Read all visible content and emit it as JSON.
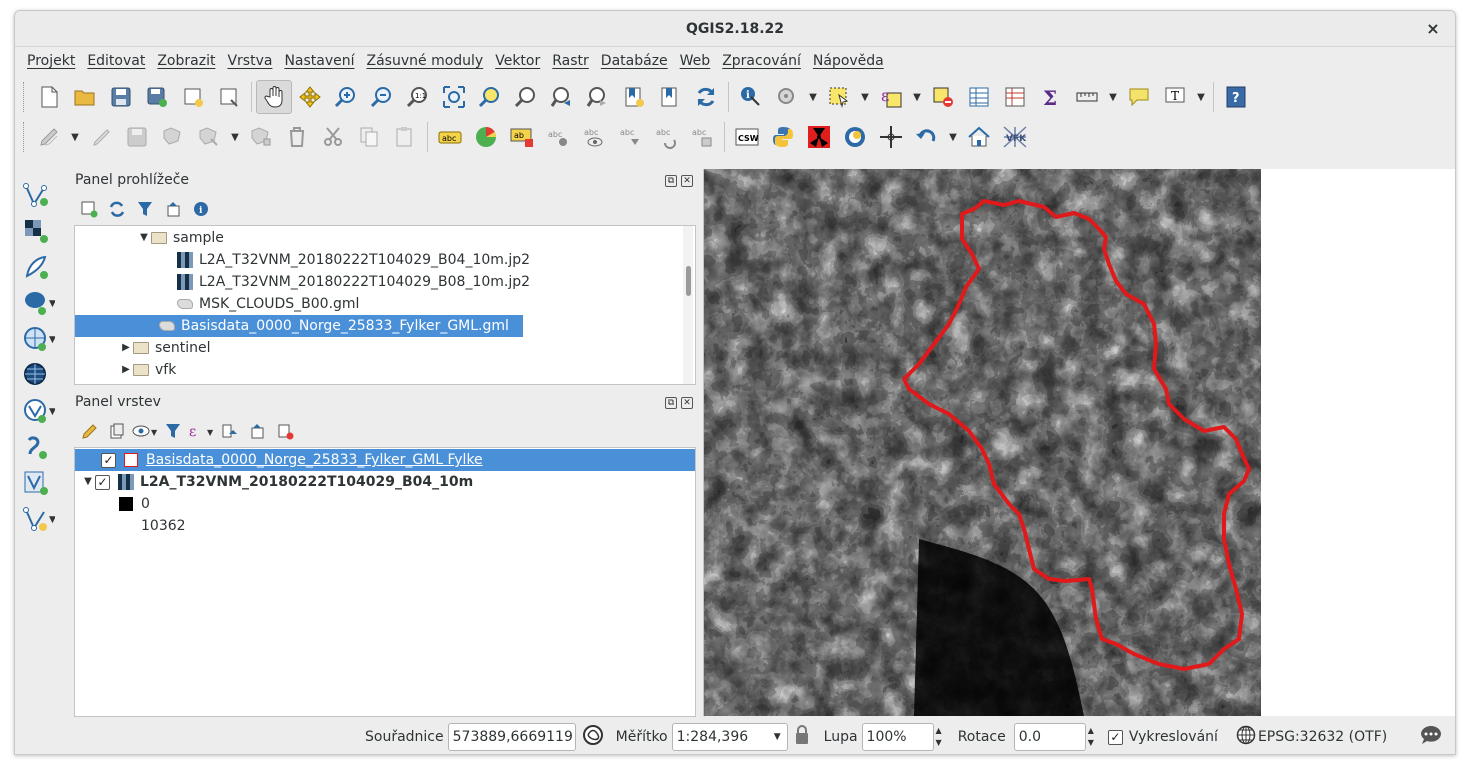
{
  "window": {
    "title": "QGIS2.18.22",
    "close": "×"
  },
  "menu": [
    "Projekt",
    "Editovat",
    "Zobrazit",
    "Vrstva",
    "Nastavení",
    "Zásuvné moduly",
    "Vektor",
    "Rastr",
    "Databáze",
    "Web",
    "Zpracování",
    "Nápověda"
  ],
  "browser_panel": {
    "title": "Panel prohlížeče",
    "items": [
      {
        "label": "sample",
        "type": "folder",
        "expanded": true
      },
      {
        "label": "L2A_T32VNM_20180222T104029_B04_10m.jp2",
        "type": "raster"
      },
      {
        "label": "L2A_T32VNM_20180222T104029_B08_10m.jp2",
        "type": "raster"
      },
      {
        "label": "MSK_CLOUDS_B00.gml",
        "type": "vector"
      },
      {
        "label": "Basisdata_0000_Norge_25833_Fylker_GML.gml",
        "type": "vector",
        "selected": true
      },
      {
        "label": "sentinel",
        "type": "folder",
        "expanded": false
      },
      {
        "label": "vfk",
        "type": "folder",
        "expanded": false
      }
    ]
  },
  "layers_panel": {
    "title": "Panel vrstev",
    "layers": [
      {
        "label": "Basisdata_0000_Norge_25833_Fylker_GML Fylke",
        "checked": true,
        "selected": true
      },
      {
        "label": "L2A_T32VNM_20180222T104029_B04_10m",
        "checked": true,
        "selected": false
      }
    ],
    "legend": {
      "min": "0",
      "max": "10362"
    }
  },
  "statusbar": {
    "coord_label": "Souřadnice",
    "coord_value": "573889,6669119",
    "scale_label": "Měřítko",
    "scale_value": "1:284,396",
    "zoom_label": "Lupa",
    "zoom_value": "100%",
    "rotation_label": "Rotace",
    "rotation_value": "0.0",
    "render_label": "Vykreslování",
    "crs": "EPSG:32632 (OTF)"
  },
  "colors": {
    "selection": "#4a90d9",
    "boundary": "#e0191b"
  }
}
